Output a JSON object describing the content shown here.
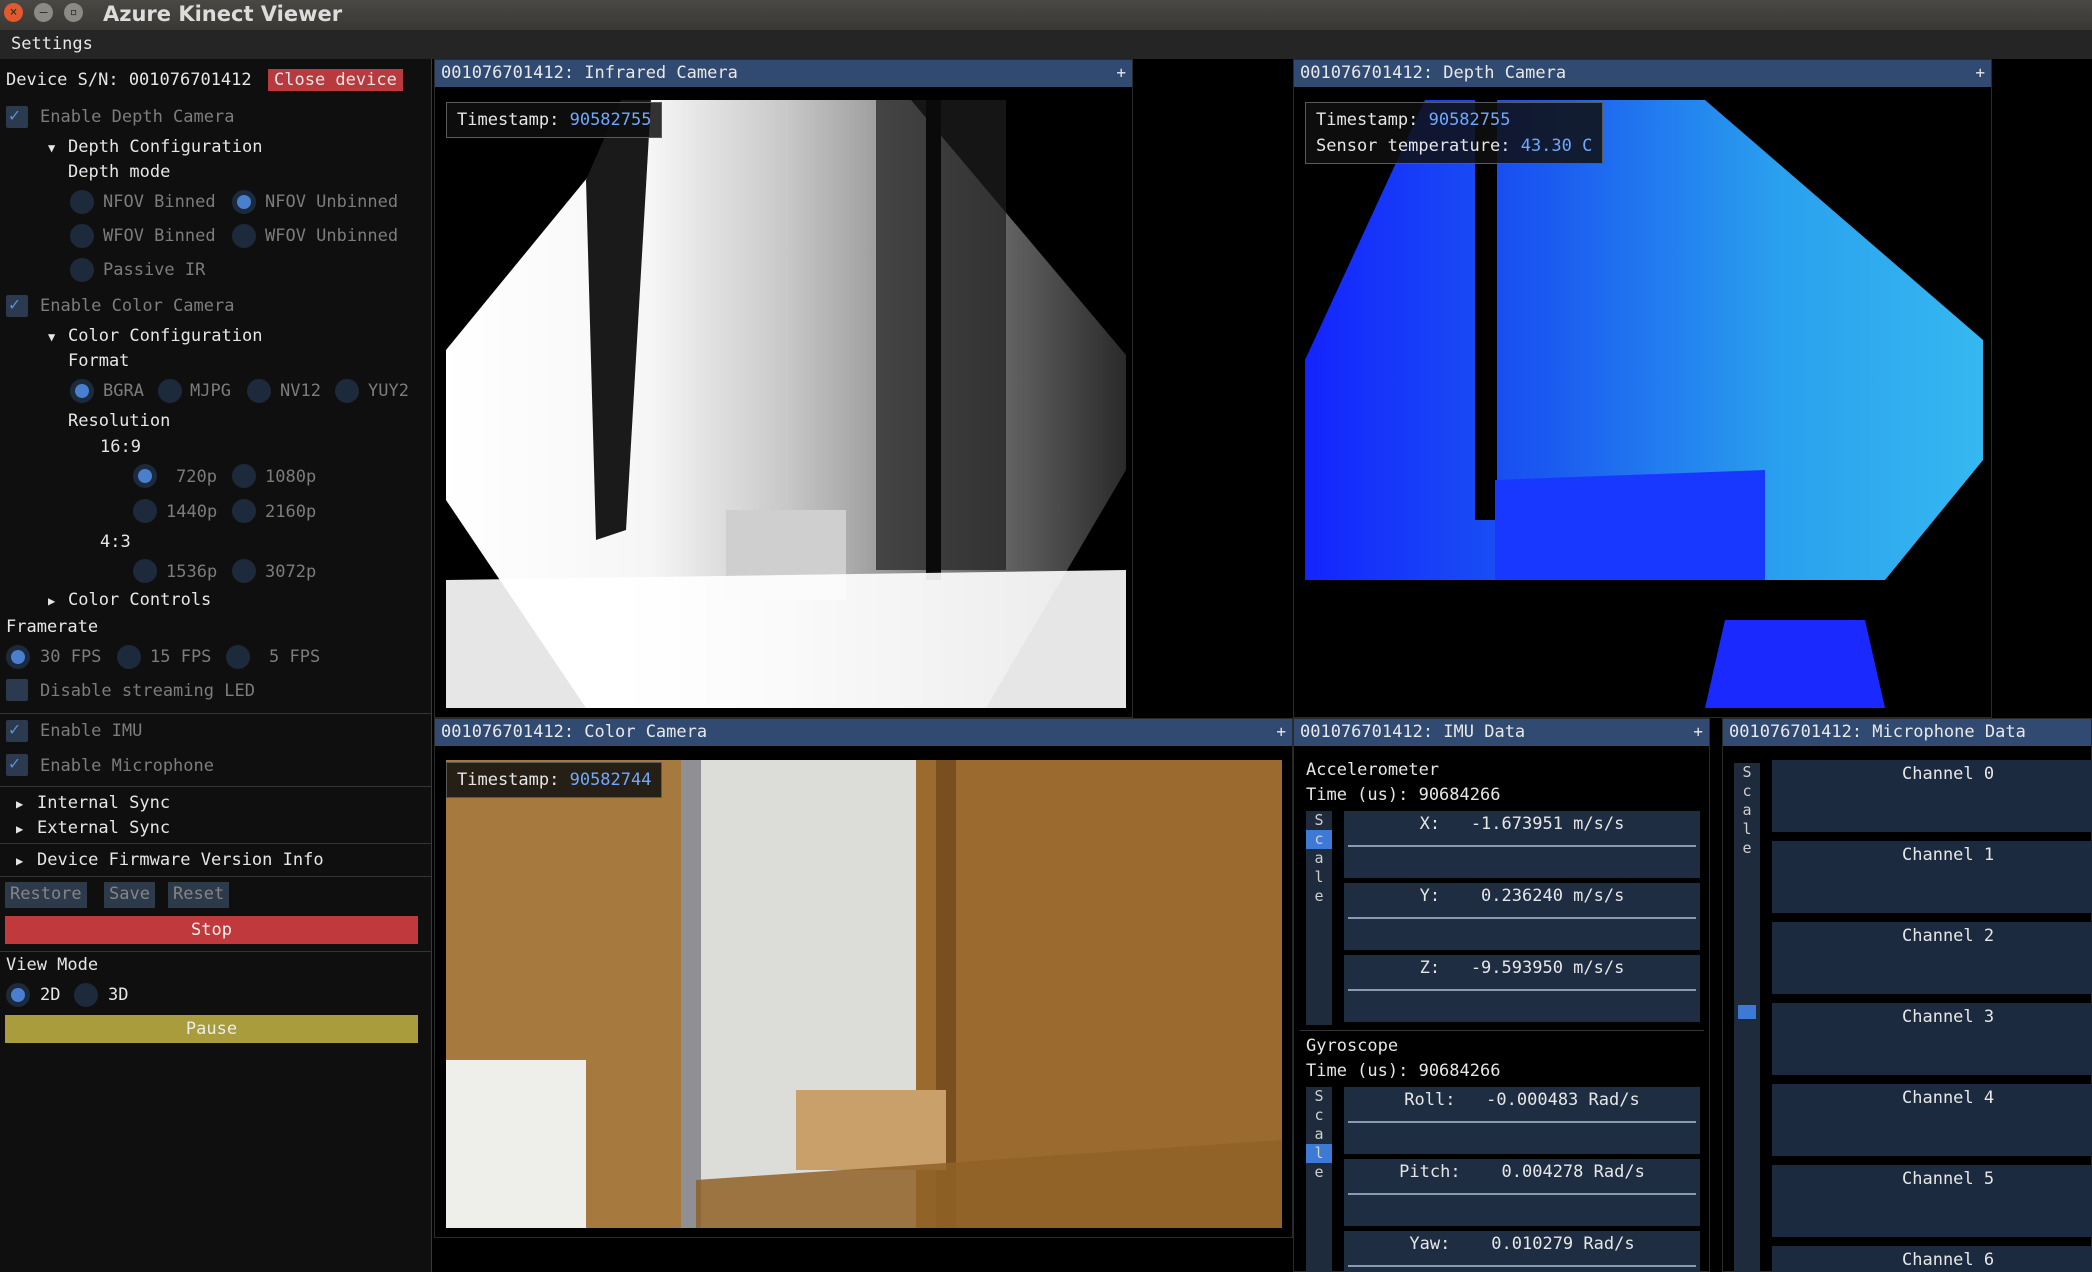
{
  "window": {
    "title": "Azure Kinect Viewer"
  },
  "menu": {
    "settings": "Settings"
  },
  "device": {
    "serial_label": "Device S/N: 001076701412",
    "close_label": "Close device"
  },
  "depth": {
    "enable_label": "Enable Depth Camera",
    "config_label": "Depth Configuration",
    "mode_label": "Depth mode",
    "modes": [
      "NFOV Binned",
      "NFOV Unbinned",
      "WFOV Binned",
      "WFOV Unbinned",
      "Passive IR"
    ],
    "selected_mode": "NFOV Unbinned"
  },
  "color": {
    "enable_label": "Enable Color Camera",
    "config_label": "Color Configuration",
    "format_label": "Format",
    "formats": [
      "BGRA",
      "MJPG",
      "NV12",
      "YUY2"
    ],
    "selected_format": "BGRA",
    "resolution_label": "Resolution",
    "ratio_169": "16:9",
    "res_169": [
      "720p",
      "1080p",
      "1440p",
      "2160p"
    ],
    "ratio_43": "4:3",
    "res_43": [
      "1536p",
      "3072p"
    ],
    "selected_res": "720p",
    "controls_label": "Color Controls"
  },
  "framerate": {
    "label": "Framerate",
    "options": [
      "30 FPS",
      "15 FPS",
      "5 FPS"
    ],
    "selected": "30 FPS"
  },
  "led": {
    "label": "Disable streaming LED"
  },
  "imu_enable": {
    "label": "Enable IMU"
  },
  "mic_enable": {
    "label": "Enable Microphone"
  },
  "sync": {
    "internal": "Internal Sync",
    "external": "External Sync"
  },
  "firmware": {
    "label": "Device Firmware Version Info"
  },
  "actions": {
    "restore": "Restore",
    "save": "Save",
    "reset": "Reset",
    "stop": "Stop",
    "pause": "Pause"
  },
  "view_mode": {
    "label": "View Mode",
    "options": [
      "2D",
      "3D"
    ],
    "selected": "2D"
  },
  "panels": {
    "ir": {
      "title": "001076701412: Infrared Camera",
      "ts_label": "Timestamp: ",
      "ts_value": "90582755"
    },
    "depth": {
      "title": "001076701412: Depth Camera",
      "ts_label": "Timestamp: ",
      "ts_value": "90582755",
      "temp_label": "Sensor temperature: ",
      "temp_value": "43.30 C"
    },
    "color": {
      "title": "001076701412: Color Camera",
      "ts_label": "Timestamp: ",
      "ts_value": "90582744"
    },
    "imu": {
      "title": "001076701412: IMU Data",
      "accel_label": "Accelerometer",
      "accel_time": "Time (us): 90684266",
      "accel": [
        "X:   -1.673951 m/s/s",
        "Y:    0.236240 m/s/s",
        "Z:   -9.593950 m/s/s"
      ],
      "gyro_label": "Gyroscope",
      "gyro_time": "Time (us): 90684266",
      "gyro": [
        "Roll:   -0.000483 Rad/s",
        "Pitch:    0.004278 Rad/s",
        "Yaw:    0.010279 Rad/s"
      ],
      "scale_letters": [
        "S",
        "c",
        "a",
        "l",
        "e"
      ]
    },
    "mic": {
      "title": "001076701412: Microphone Data",
      "channels": [
        "Channel 0",
        "Channel 1",
        "Channel 2",
        "Channel 3",
        "Channel 4",
        "Channel 5",
        "Channel 6"
      ]
    }
  },
  "colors": {
    "accent": "#304a71",
    "stop": "#c0393d",
    "pause": "#a89c3c",
    "close": "#b83a3e",
    "value_blue": "#6ea8ff"
  },
  "icons": {
    "close": "close-icon",
    "minimize": "minimize-icon",
    "maximize": "maximize-icon",
    "expand": "triangle-icon",
    "check": "check-icon",
    "plus": "plus-icon"
  }
}
